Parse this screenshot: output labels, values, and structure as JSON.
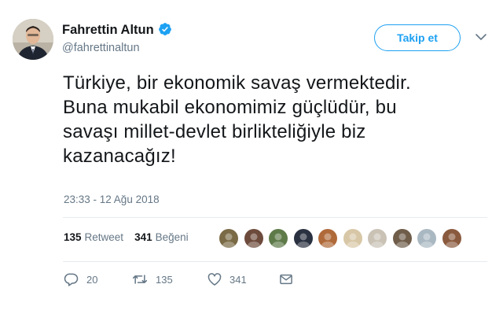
{
  "author": {
    "display_name": "Fahrettin Altun",
    "handle": "@fahrettinaltun",
    "verified": true
  },
  "follow_button_label": "Takip et",
  "tweet": {
    "lines": [
      "Türkiye, bir ekonomik savaş vermektedir.",
      "Buna mukabil ekonomimiz güçlüdür, bu",
      "savaşı millet-devlet birlikteliğiyle biz",
      "kazanacağız!"
    ],
    "timestamp": "23:33 - 12 Ağu 2018"
  },
  "stats": {
    "retweets_count": "135",
    "retweets_label": "Retweet",
    "likes_count": "341",
    "likes_label": "Beğeni"
  },
  "likers": [
    {
      "icon": "user-avatar",
      "color": "#7a6a45"
    },
    {
      "icon": "user-avatar",
      "color": "#6d4b3c"
    },
    {
      "icon": "user-avatar",
      "color": "#5e7a49"
    },
    {
      "icon": "user-avatar",
      "color": "#2a3140"
    },
    {
      "icon": "user-avatar",
      "color": "#b06a3a"
    },
    {
      "icon": "user-avatar",
      "color": "#d8c7a6"
    },
    {
      "icon": "user-avatar",
      "color": "#c9c2b5"
    },
    {
      "icon": "user-avatar",
      "color": "#6f5d4a"
    },
    {
      "icon": "user-avatar",
      "color": "#aab8c2"
    },
    {
      "icon": "user-avatar",
      "color": "#8a5a3e"
    }
  ],
  "actions": {
    "reply_count": "20",
    "retweet_count": "135",
    "like_count": "341"
  },
  "colors": {
    "accent": "#1da1f2",
    "text": "#14171a",
    "secondary": "#657786",
    "divider": "#e6ecf0"
  }
}
